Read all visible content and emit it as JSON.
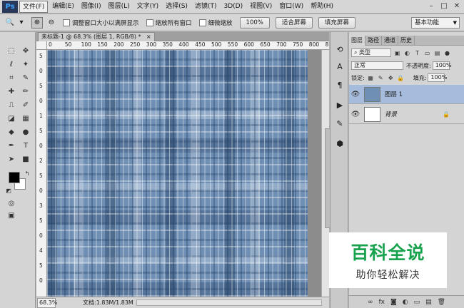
{
  "app": {
    "logo": "Ps"
  },
  "menu": [
    "文件(F)",
    "编辑(E)",
    "图像(I)",
    "图层(L)",
    "文字(Y)",
    "选择(S)",
    "滤镜(T)",
    "3D(D)",
    "视图(V)",
    "窗口(W)",
    "帮助(H)"
  ],
  "window_controls": {
    "minimize": "–",
    "restore": "□",
    "close": "✕"
  },
  "options": {
    "tool_glyph": "🔍",
    "zoom_in_glyph": "⊕",
    "zoom_out_glyph": "⊖",
    "resize_windows": "调整窗口大小以满屏显示",
    "zoom_all": "缩放所有窗口",
    "scrubby_zoom": "细微缩放",
    "zoom_value": "100%",
    "fit_screen": "适合屏幕",
    "fill_screen": "填充屏幕",
    "workspace": "基本功能"
  },
  "document": {
    "tab_title": "未标题-1 @ 68.3% (图层 1, RGB/8) *",
    "close": "×",
    "ruler_ticks": [
      "0",
      "50",
      "100",
      "150",
      "200",
      "250",
      "300",
      "350",
      "400",
      "450",
      "500",
      "550",
      "600",
      "650",
      "700",
      "750",
      "800",
      "8"
    ],
    "vruler_ticks": [
      "5",
      "0",
      "5",
      "0",
      "1",
      "5",
      "0",
      "2",
      "5",
      "0",
      "3",
      "5",
      "0",
      "4",
      "5",
      "0"
    ],
    "zoom": "68.3%",
    "doc_size": "文档:1.83M/1.83M"
  },
  "layers_panel": {
    "tabs": [
      "图层",
      "路径",
      "通道",
      "历史"
    ],
    "filter_kind": "类型",
    "blend_mode": "正常",
    "opacity_label": "不透明度:",
    "opacity": "100%",
    "lock_label": "锁定:",
    "fill_label": "填充:",
    "fill": "100%",
    "layers": [
      {
        "name": "图层 1",
        "selected": true
      },
      {
        "name": "背景",
        "selected": false
      }
    ],
    "footer_icons": [
      "∞",
      "fx",
      "◙",
      "◐",
      "▭",
      "▤",
      "🗑"
    ]
  },
  "watermark": {
    "title": "百科全说",
    "subtitle": "助你轻松解决"
  },
  "colors": {
    "selected_layer": "#a6bcdc",
    "canvas_base": "#6f8fb4",
    "watermark_green": "#1aa34f"
  }
}
